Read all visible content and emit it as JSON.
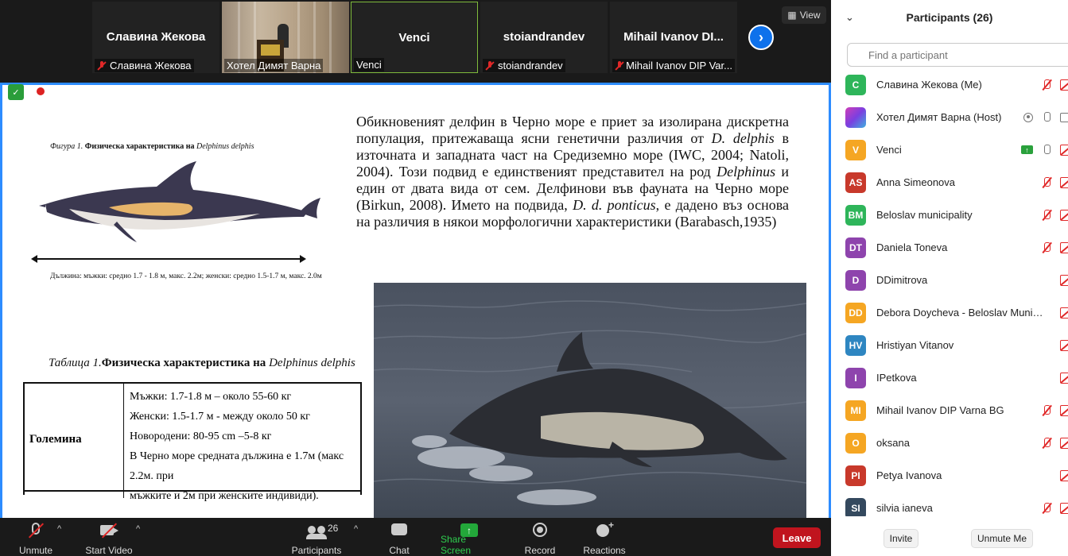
{
  "gallery": {
    "tiles": [
      {
        "name": "Славина Жекова",
        "label": "Славина Жекова"
      },
      {
        "name": "",
        "label": "Хотел Димят Варна"
      },
      {
        "name": "Venci",
        "label": "Venci"
      },
      {
        "name": "stoiandrandev",
        "label": "stoiandrandev"
      },
      {
        "name": "Mihail Ivanov DI...",
        "label": "Mihail Ivanov DIP Var..."
      }
    ],
    "view_label": "View"
  },
  "slide": {
    "figure_caption_prefix": "Фигура 1.",
    "figure_caption_text": "Физическа характеристика на",
    "figure_caption_species": "Delphinus delphis",
    "length_note": "Дължина: мъжки: средно 1.7 - 1.8 м, макс. 2.2м; женски: средно 1.5-1.7 м, макс. 2.0м",
    "table_caption_prefix": "Таблица 1.",
    "table_caption_text": "Физическа характеристика на",
    "table_caption_species": "Delphinus delphis",
    "table_row_label": "Големина",
    "table_lines": [
      "Мъжки:      1.7-1.8 м – около 55-60  кг",
      "Женски: 1.5-1.7 м - между около 50 кг",
      "Новородени:  80-95 cm –5-8  кг",
      "В Черно море средната дължина е 1.7м (макс 2.2м. при",
      "мъжките и 2м при женските индивиди)."
    ],
    "text_1": "Обикновеният делфин в Черно море е приет за изолирана дискретна популация, притежаваща ясни генетични различия от ",
    "text_species_1": "D. delphis",
    "text_2": " в източната и западната част на Средиземно море (IWC, 2004; Natoli, 2004). Този подвид е единственият представител на род ",
    "text_genus": "Delphinus",
    "text_3": " и един от двата вида от сем. Делфинови във фауната на Черно море (Birkun, 2008). Името на подвида, ",
    "text_species_2": "D. d. ponticus",
    "text_4": ", е дадено въз основа на различия в някои морфологични характеристики (Barabasch,1935)"
  },
  "participants_panel": {
    "title": "Participants (26)",
    "search_placeholder": "Find a participant",
    "participants": [
      {
        "initials": "C",
        "name": "Славина Жекова (Me)",
        "color": "#2eb55a"
      },
      {
        "initials": "",
        "name": "Хотел Димят Варна (Host)",
        "color": "#9b3fd0"
      },
      {
        "initials": "V",
        "name": "Venci",
        "color": "#f5a623"
      },
      {
        "initials": "AS",
        "name": "Anna Simeonova",
        "color": "#c8392b"
      },
      {
        "initials": "BM",
        "name": "Beloslav municipality",
        "color": "#2eb55a"
      },
      {
        "initials": "DT",
        "name": "Daniela Toneva",
        "color": "#8e44ad"
      },
      {
        "initials": "D",
        "name": "DDimitrova",
        "color": "#8e44ad"
      },
      {
        "initials": "DD",
        "name": "Debora Doycheva -  Beloslav Munici...",
        "color": "#f5a623"
      },
      {
        "initials": "HV",
        "name": "Hristiyan Vitanov",
        "color": "#2e86c1"
      },
      {
        "initials": "I",
        "name": "IPetkova",
        "color": "#8e44ad"
      },
      {
        "initials": "MI",
        "name": "Mihail Ivanov DIP Varna BG",
        "color": "#f5a623"
      },
      {
        "initials": "O",
        "name": "oksana",
        "color": "#f5a623"
      },
      {
        "initials": "PI",
        "name": "Petya Ivanova",
        "color": "#c8392b"
      },
      {
        "initials": "SI",
        "name": "silvia ianeva",
        "color": "#34495e"
      }
    ],
    "invite_label": "Invite",
    "unmute_me_label": "Unmute Me"
  },
  "toolbar": {
    "unmute": "Unmute",
    "start_video": "Start Video",
    "participants": "Participants",
    "participants_count": "26",
    "chat": "Chat",
    "share_screen": "Share Screen",
    "record": "Record",
    "reactions": "Reactions",
    "leave": "Leave"
  }
}
